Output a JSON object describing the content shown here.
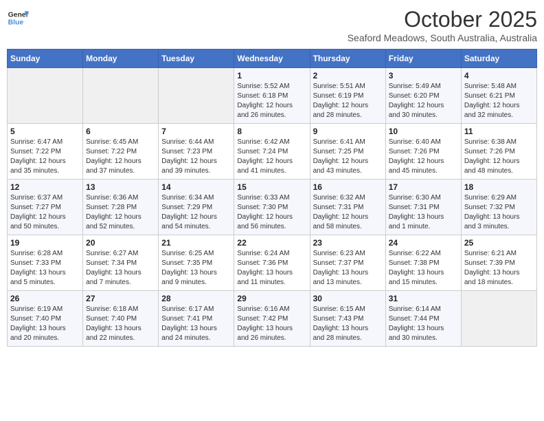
{
  "logo": {
    "line1": "General",
    "line2": "Blue"
  },
  "title": "October 2025",
  "subtitle": "Seaford Meadows, South Australia, Australia",
  "days_of_week": [
    "Sunday",
    "Monday",
    "Tuesday",
    "Wednesday",
    "Thursday",
    "Friday",
    "Saturday"
  ],
  "weeks": [
    [
      {
        "day": "",
        "info": ""
      },
      {
        "day": "",
        "info": ""
      },
      {
        "day": "",
        "info": ""
      },
      {
        "day": "1",
        "info": "Sunrise: 5:52 AM\nSunset: 6:18 PM\nDaylight: 12 hours\nand 26 minutes."
      },
      {
        "day": "2",
        "info": "Sunrise: 5:51 AM\nSunset: 6:19 PM\nDaylight: 12 hours\nand 28 minutes."
      },
      {
        "day": "3",
        "info": "Sunrise: 5:49 AM\nSunset: 6:20 PM\nDaylight: 12 hours\nand 30 minutes."
      },
      {
        "day": "4",
        "info": "Sunrise: 5:48 AM\nSunset: 6:21 PM\nDaylight: 12 hours\nand 32 minutes."
      }
    ],
    [
      {
        "day": "5",
        "info": "Sunrise: 6:47 AM\nSunset: 7:22 PM\nDaylight: 12 hours\nand 35 minutes."
      },
      {
        "day": "6",
        "info": "Sunrise: 6:45 AM\nSunset: 7:22 PM\nDaylight: 12 hours\nand 37 minutes."
      },
      {
        "day": "7",
        "info": "Sunrise: 6:44 AM\nSunset: 7:23 PM\nDaylight: 12 hours\nand 39 minutes."
      },
      {
        "day": "8",
        "info": "Sunrise: 6:42 AM\nSunset: 7:24 PM\nDaylight: 12 hours\nand 41 minutes."
      },
      {
        "day": "9",
        "info": "Sunrise: 6:41 AM\nSunset: 7:25 PM\nDaylight: 12 hours\nand 43 minutes."
      },
      {
        "day": "10",
        "info": "Sunrise: 6:40 AM\nSunset: 7:26 PM\nDaylight: 12 hours\nand 45 minutes."
      },
      {
        "day": "11",
        "info": "Sunrise: 6:38 AM\nSunset: 7:26 PM\nDaylight: 12 hours\nand 48 minutes."
      }
    ],
    [
      {
        "day": "12",
        "info": "Sunrise: 6:37 AM\nSunset: 7:27 PM\nDaylight: 12 hours\nand 50 minutes."
      },
      {
        "day": "13",
        "info": "Sunrise: 6:36 AM\nSunset: 7:28 PM\nDaylight: 12 hours\nand 52 minutes."
      },
      {
        "day": "14",
        "info": "Sunrise: 6:34 AM\nSunset: 7:29 PM\nDaylight: 12 hours\nand 54 minutes."
      },
      {
        "day": "15",
        "info": "Sunrise: 6:33 AM\nSunset: 7:30 PM\nDaylight: 12 hours\nand 56 minutes."
      },
      {
        "day": "16",
        "info": "Sunrise: 6:32 AM\nSunset: 7:31 PM\nDaylight: 12 hours\nand 58 minutes."
      },
      {
        "day": "17",
        "info": "Sunrise: 6:30 AM\nSunset: 7:31 PM\nDaylight: 13 hours\nand 1 minute."
      },
      {
        "day": "18",
        "info": "Sunrise: 6:29 AM\nSunset: 7:32 PM\nDaylight: 13 hours\nand 3 minutes."
      }
    ],
    [
      {
        "day": "19",
        "info": "Sunrise: 6:28 AM\nSunset: 7:33 PM\nDaylight: 13 hours\nand 5 minutes."
      },
      {
        "day": "20",
        "info": "Sunrise: 6:27 AM\nSunset: 7:34 PM\nDaylight: 13 hours\nand 7 minutes."
      },
      {
        "day": "21",
        "info": "Sunrise: 6:25 AM\nSunset: 7:35 PM\nDaylight: 13 hours\nand 9 minutes."
      },
      {
        "day": "22",
        "info": "Sunrise: 6:24 AM\nSunset: 7:36 PM\nDaylight: 13 hours\nand 11 minutes."
      },
      {
        "day": "23",
        "info": "Sunrise: 6:23 AM\nSunset: 7:37 PM\nDaylight: 13 hours\nand 13 minutes."
      },
      {
        "day": "24",
        "info": "Sunrise: 6:22 AM\nSunset: 7:38 PM\nDaylight: 13 hours\nand 15 minutes."
      },
      {
        "day": "25",
        "info": "Sunrise: 6:21 AM\nSunset: 7:39 PM\nDaylight: 13 hours\nand 18 minutes."
      }
    ],
    [
      {
        "day": "26",
        "info": "Sunrise: 6:19 AM\nSunset: 7:40 PM\nDaylight: 13 hours\nand 20 minutes."
      },
      {
        "day": "27",
        "info": "Sunrise: 6:18 AM\nSunset: 7:40 PM\nDaylight: 13 hours\nand 22 minutes."
      },
      {
        "day": "28",
        "info": "Sunrise: 6:17 AM\nSunset: 7:41 PM\nDaylight: 13 hours\nand 24 minutes."
      },
      {
        "day": "29",
        "info": "Sunrise: 6:16 AM\nSunset: 7:42 PM\nDaylight: 13 hours\nand 26 minutes."
      },
      {
        "day": "30",
        "info": "Sunrise: 6:15 AM\nSunset: 7:43 PM\nDaylight: 13 hours\nand 28 minutes."
      },
      {
        "day": "31",
        "info": "Sunrise: 6:14 AM\nSunset: 7:44 PM\nDaylight: 13 hours\nand 30 minutes."
      },
      {
        "day": "",
        "info": ""
      }
    ]
  ]
}
